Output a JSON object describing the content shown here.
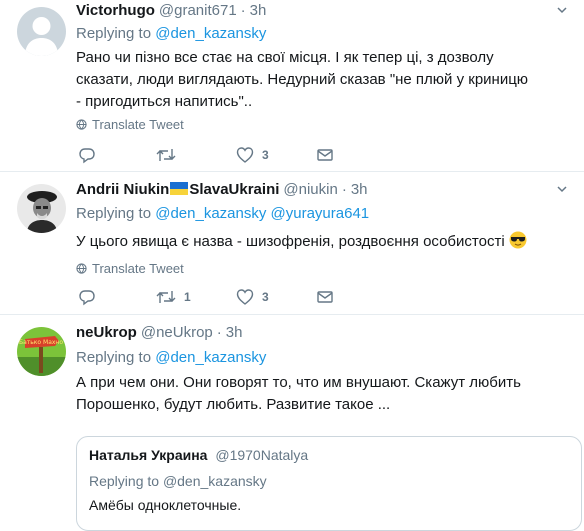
{
  "tweets": [
    {
      "name": "Victorhugo",
      "handle": "@granit671",
      "time": "3h",
      "replying_prefix": "Replying to",
      "mentions": [
        "@den_kazansky"
      ],
      "text": "Рано чи пізно все стає на свої місця. І як тепер ці, з дозволу сказати, люди виглядають. Недурний сказав \"не плюй у криницю - пригодиться напитись\"..",
      "translate_label": "Translate Tweet",
      "reply_count": "",
      "retweet_count": "",
      "like_count": "3"
    },
    {
      "name": "Andrii Niukin",
      "name_suffix": "SlavaUkraini",
      "handle": "@niukin",
      "time": "3h",
      "replying_prefix": "Replying to",
      "mentions": [
        "@den_kazansky",
        "@yurayura641"
      ],
      "text": "У цього явища є назва - шизофренія, роздвоєння особистості",
      "translate_label": "Translate Tweet",
      "reply_count": "",
      "retweet_count": "1",
      "like_count": "3"
    },
    {
      "name": "neUkrop",
      "handle": "@neUkrop",
      "time": "3h",
      "replying_prefix": "Replying to",
      "mentions": [
        "@den_kazansky"
      ],
      "text": "А при чем они. Они говорят то, что им внушают. Скажут любить Порошенко, будут любить. Развитие такое ...",
      "avatar_sign": "Батько Махно",
      "quote": {
        "name": "Наталья Украина",
        "handle": "@1970Natalya",
        "replying_prefix": "Replying to",
        "mention": "@den_kazansky",
        "text": "Амёбы одноклеточные."
      }
    }
  ],
  "colors": {
    "link": "#1b95e0",
    "muted": "#657786",
    "border": "#e6ecf0"
  }
}
